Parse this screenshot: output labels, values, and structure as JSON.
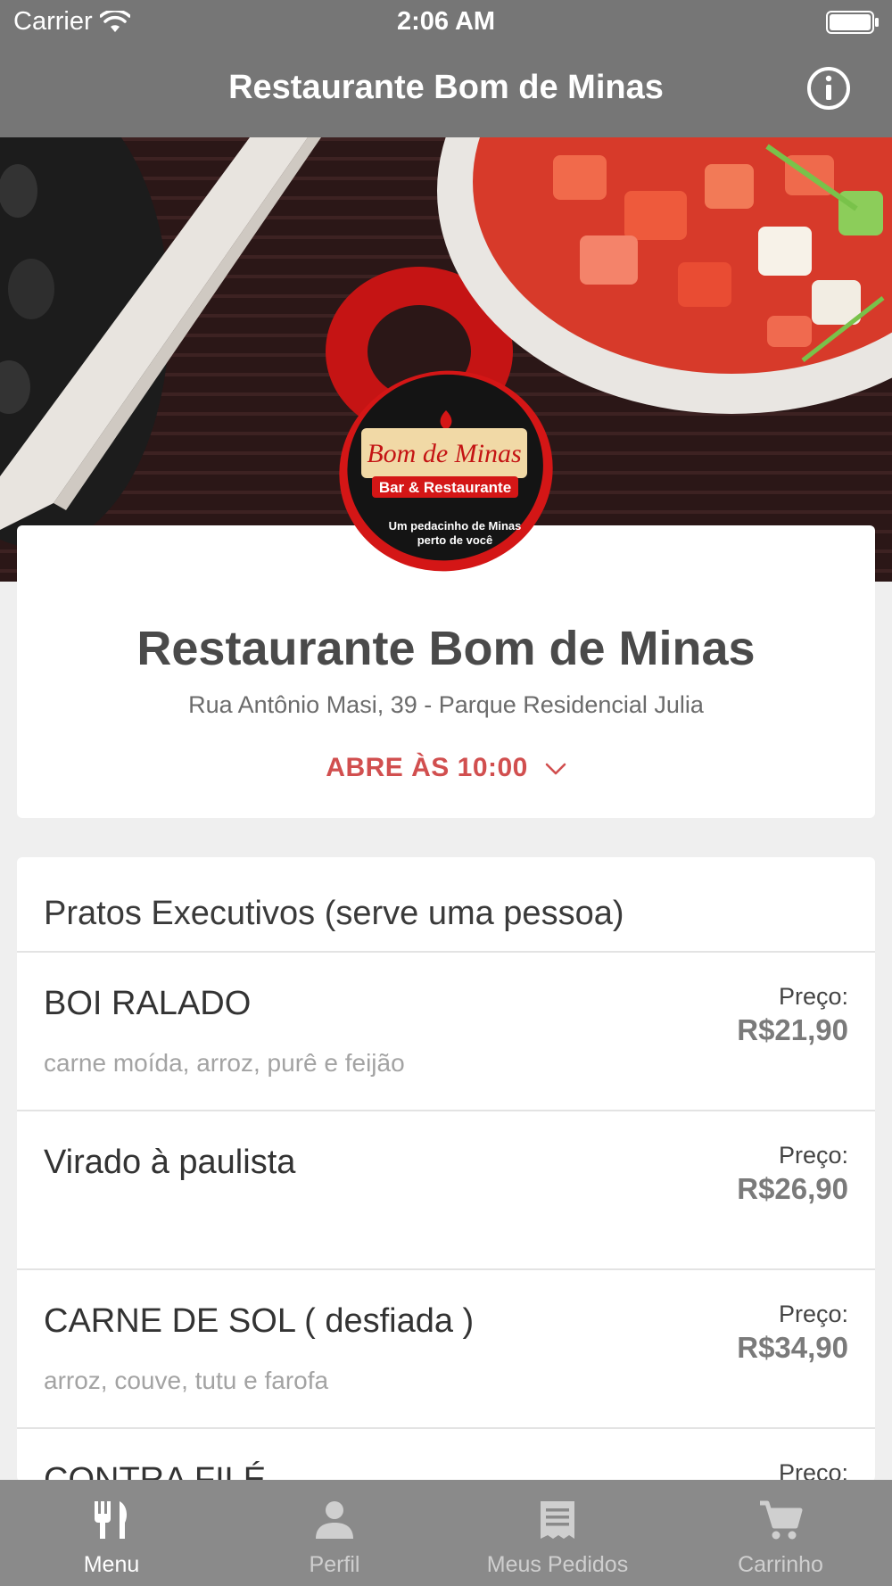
{
  "status_bar": {
    "carrier": "Carrier",
    "time": "2:06 AM"
  },
  "nav": {
    "title": "Restaurante Bom de Minas",
    "info_icon": "info-icon"
  },
  "logo": {
    "name": "Bom de Minas",
    "subtitle": "Bar & Restaurante",
    "tagline_line1": "Um pedacinho de Minas",
    "tagline_line2": "perto de você"
  },
  "restaurant": {
    "name": "Restaurante Bom de Minas",
    "address": "Rua Antônio Masi, 39 - Parque Residencial Julia",
    "opening": "ABRE ÀS 10:00"
  },
  "menu": {
    "section_title": "Pratos Executivos (serve uma pessoa)",
    "price_label": "Preço:",
    "items": [
      {
        "name": "BOI RALADO",
        "description": "carne moída, arroz, purê e feijão",
        "price": "R$21,90"
      },
      {
        "name": "Virado à paulista",
        "description": "",
        "price": "R$26,90"
      },
      {
        "name": "CARNE DE SOL ( desfiada )",
        "description": "arroz, couve, tutu e farofa",
        "price": "R$34,90"
      },
      {
        "name": "CONTRA FILÉ",
        "description": "",
        "price": ""
      }
    ]
  },
  "tabs": [
    {
      "label": "Menu",
      "icon": "fork-knife-icon",
      "active": true
    },
    {
      "label": "Perfil",
      "icon": "person-icon",
      "active": false
    },
    {
      "label": "Meus Pedidos",
      "icon": "receipt-icon",
      "active": false
    },
    {
      "label": "Carrinho",
      "icon": "cart-icon",
      "active": false
    }
  ],
  "colors": {
    "accent": "#d14f4f",
    "topbar": "#767676",
    "tabbar": "#8a8a8a"
  }
}
